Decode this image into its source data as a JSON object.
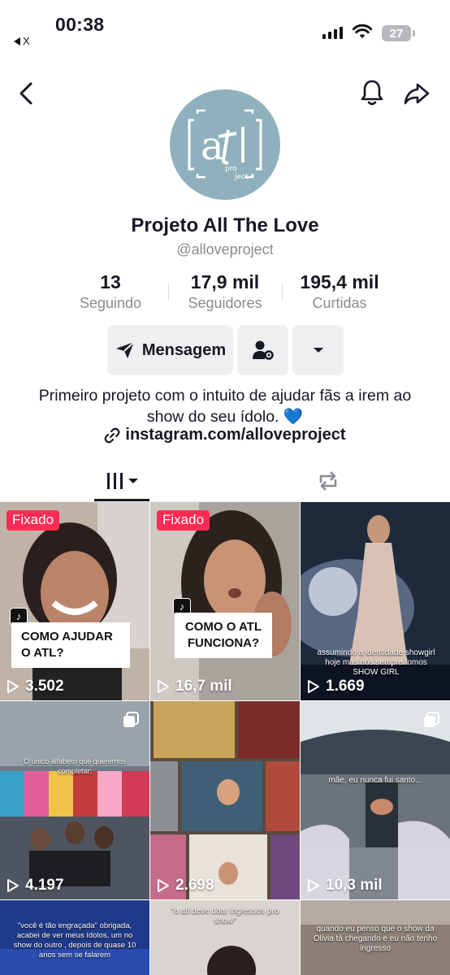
{
  "status_bar": {
    "time": "00:38",
    "back_app_label": "X",
    "battery": "27"
  },
  "profile": {
    "display_name": "Projeto All The Love",
    "username": "@alloveproject",
    "avatar_text": "atl",
    "avatar_subtext": "pro ject"
  },
  "stats": [
    {
      "value": "13",
      "label": "Seguindo"
    },
    {
      "value": "17,9 mil",
      "label": "Seguidores"
    },
    {
      "value": "195,4 mil",
      "label": "Curtidas"
    }
  ],
  "actions": {
    "message_label": "Mensagem"
  },
  "bio": {
    "text": "Primeiro projeto com o intuito de ajudar fãs a irem ao show do seu ídolo. 💙",
    "link": "instagram.com/alloveproject"
  },
  "grid": {
    "pinned_label": "Fixado",
    "videos": [
      {
        "views": "3.502",
        "pinned": true,
        "caption": "COMO AJUDAR O ATL?"
      },
      {
        "views": "16,7 mil",
        "pinned": true,
        "caption": "COMO O ATL FUNCIONA?"
      },
      {
        "views": "1.669",
        "pinned": false,
        "overlay": "assumindo a identidade showgirl hoje mas nós sempre fomos SHOW GIRL"
      },
      {
        "views": "4.197",
        "pinned": false,
        "overlay": "O único alfabeto que queremos completar:"
      },
      {
        "views": "2.698",
        "pinned": false,
        "overlay": ""
      },
      {
        "views": "10,3 mil",
        "pinned": false,
        "overlay": "mãe, eu nunca fui santo..."
      },
      {
        "views": "",
        "pinned": false,
        "overlay": "\"você é tão engraçada\" obrigada, acabei de ver meus ídolos, um no show do outro , depois de quase 10 anos sem se falarem"
      },
      {
        "views": "",
        "pinned": false,
        "overlay": "\"o atl deve doar ingressos pro show\""
      },
      {
        "views": "",
        "pinned": false,
        "overlay": "quando eu penso que o show da Olivia tá chegando e eu não tenho ingresso"
      }
    ]
  },
  "colors": {
    "pinned_badge": "#fe2c55",
    "avatar_bg": "#8fb1bd",
    "secondary_text": "#8a8b91",
    "button_bg": "#efeff1"
  },
  "icons": {
    "nav": [
      "chevron-left-icon",
      "bell-icon",
      "share-icon"
    ],
    "tabs": [
      "grid-icon",
      "repost-icon"
    ]
  }
}
